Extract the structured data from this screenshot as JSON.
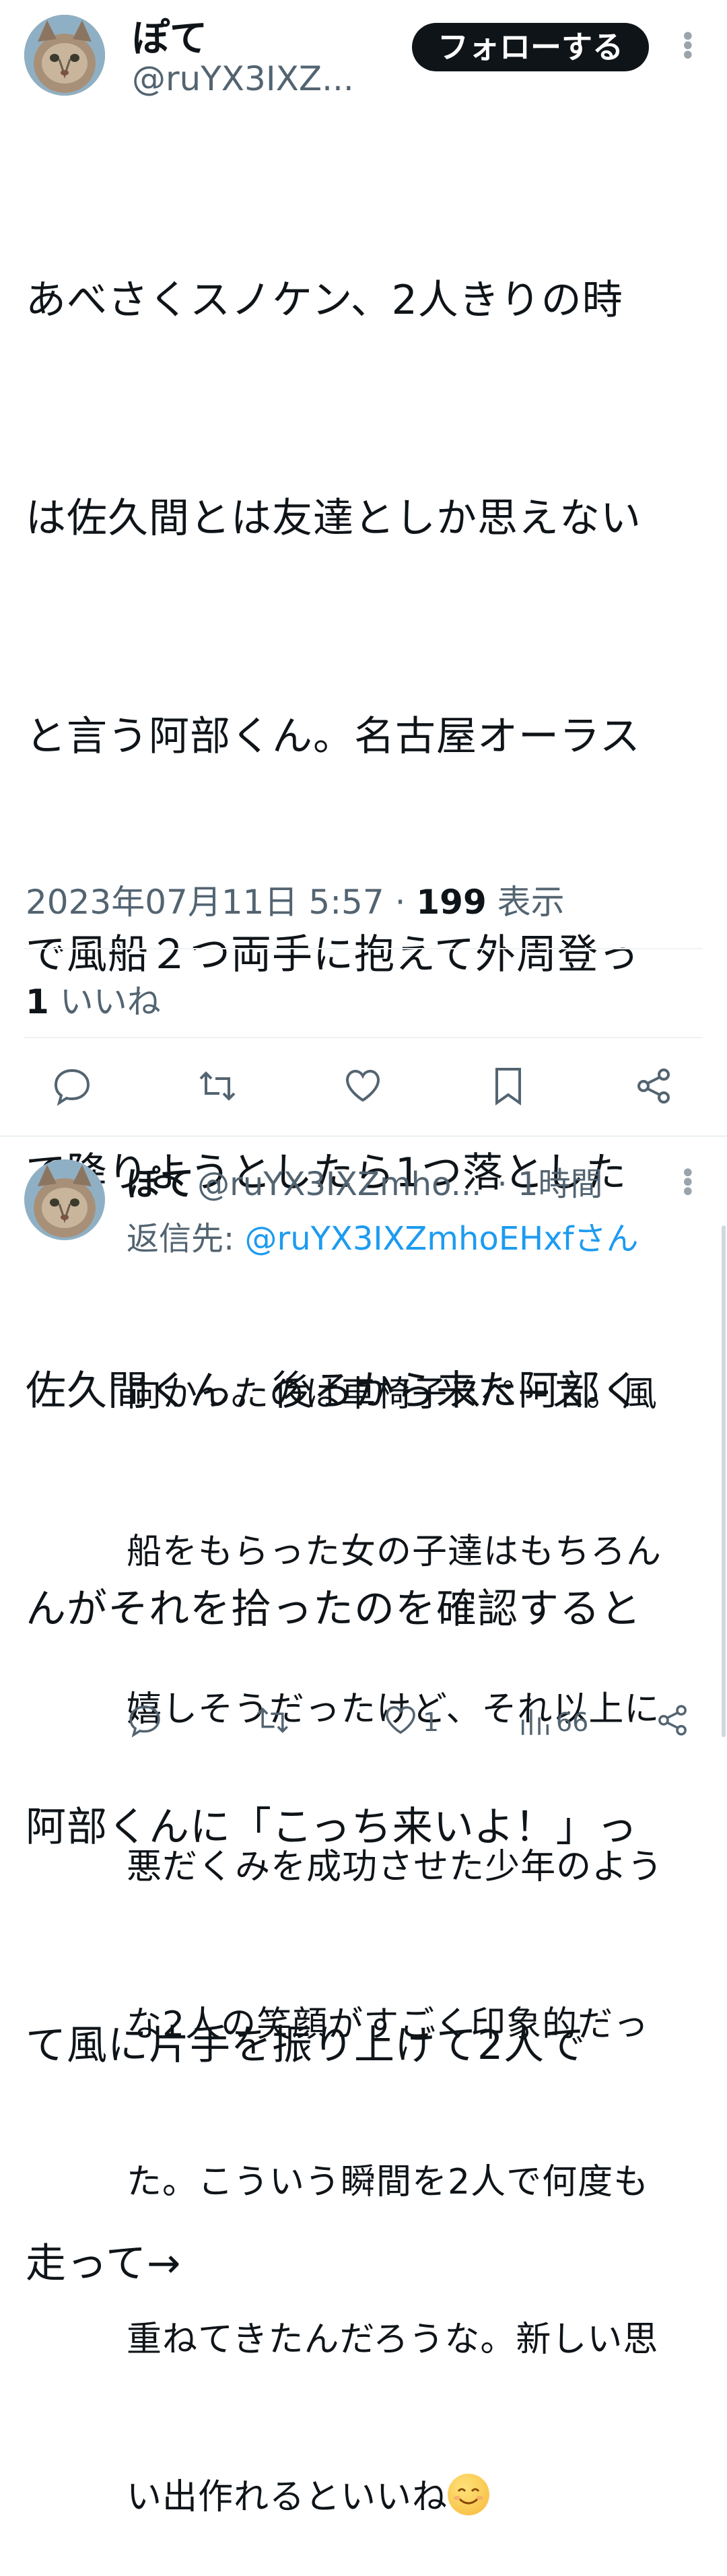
{
  "tweet": {
    "display_name": "ぽて",
    "handle": "@ruYX3IXZ...",
    "follow_label": "フォローする",
    "lines": [
      "あべさくスノケン、2人きりの時",
      "は佐久間とは友達としか思えない",
      "と言う阿部くん。名古屋オーラス",
      "で風船２つ両手に抱えて外周登っ",
      "て降りようとしたら1つ落とした",
      "佐久間くん。後ろから来た阿部く",
      "んがそれを拾ったのを確認すると",
      "阿部くんに「こっち来いよ！」っ",
      "て風に片手を振り上げて2人で",
      "走って→"
    ],
    "timestamp": "2023年07月11日 5:57",
    "separator": "·",
    "views": "199",
    "views_label": "表示",
    "likes_count": "1",
    "likes_label": "いいね",
    "actions": [
      "reply-icon",
      "retweet-icon",
      "like-icon",
      "bookmark-icon",
      "share-icon"
    ]
  },
  "reply": {
    "display_name": "ぽて",
    "handle": "@ruYX3IXZmho...",
    "time": "· 1時間",
    "reply_prefix": "返信先:",
    "reply_mention": "@ruYX3IXZmhoEHxfさん",
    "lines": [
      "向かったのは車椅子スペース。風",
      "船をもらった女の子達はもちろん",
      "嬉しそうだったけど、それ以上に",
      "悪だくみを成功させた少年のよう",
      "な2人の笑顔がすごく印象的だっ",
      "た。こういう瞬間を2人で何度も",
      "重ねてきたんだろうな。新しい思",
      "い出作れるといいね"
    ],
    "emoji": "smiling-face-emoji",
    "like_count": "1",
    "view_count": "66"
  },
  "colors": {
    "text": "#0f1419",
    "secondary": "#536471",
    "link": "#1d9bf0",
    "follow_bg": "#0f1419",
    "divider": "#eff3f4"
  }
}
